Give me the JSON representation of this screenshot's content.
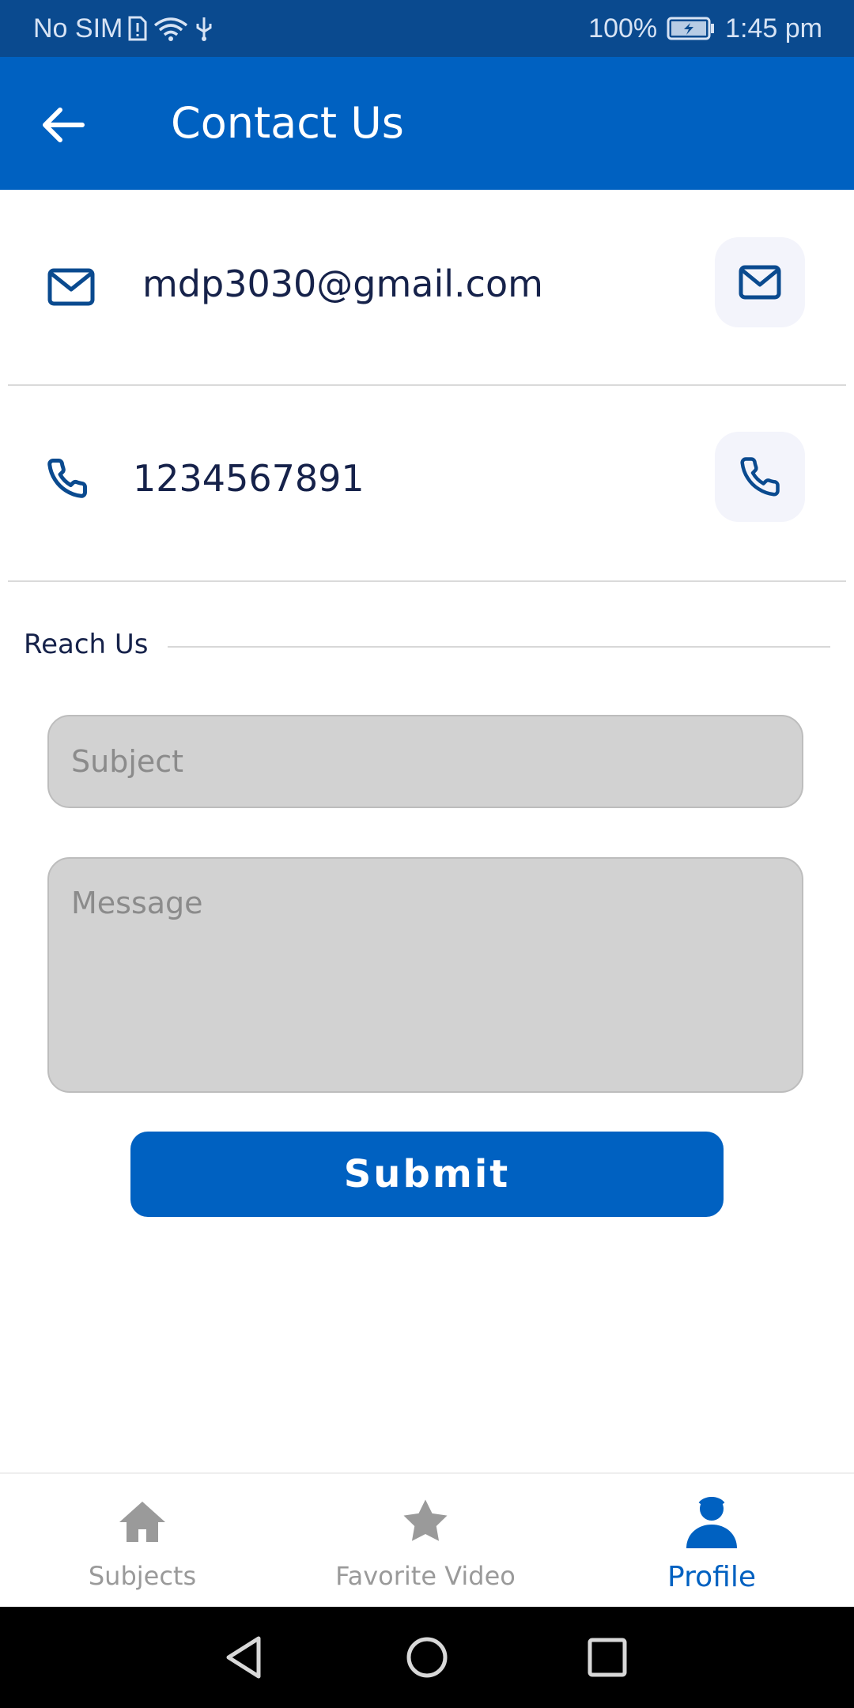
{
  "status_bar": {
    "carrier": "No SIM",
    "battery": "100%",
    "time": "1:45 pm"
  },
  "app_bar": {
    "title": "Contact Us"
  },
  "contact": {
    "email": "mdp3030@gmail.com",
    "phone": "1234567891"
  },
  "reach_us": {
    "heading": "Reach Us",
    "subject_placeholder": "Subject",
    "message_placeholder": "Message",
    "submit_label": "Submit"
  },
  "bottom_nav": {
    "items": [
      {
        "label": "Subjects",
        "icon": "home-icon",
        "active": false
      },
      {
        "label": "Favorite Video",
        "icon": "star-icon",
        "active": false
      },
      {
        "label": "Profile",
        "icon": "person-icon",
        "active": true
      }
    ]
  },
  "colors": {
    "primary": "#0061c1",
    "status_bar": "#0a4a8f",
    "text_dark": "#16224a",
    "field_bg": "#d2d2d2",
    "inactive": "#9a9a9a"
  }
}
